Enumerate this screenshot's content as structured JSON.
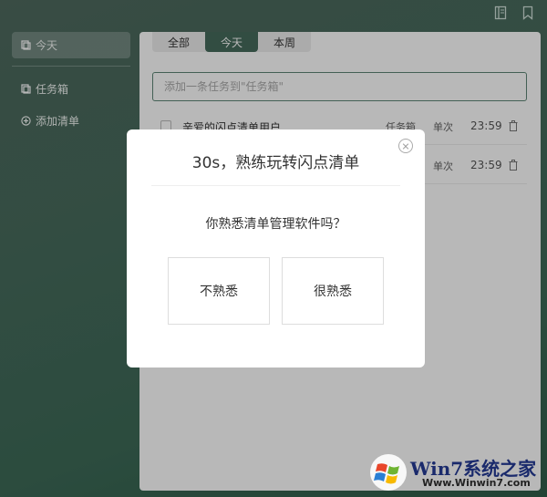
{
  "sidebar": {
    "today_label": "今天",
    "inbox_label": "任务箱",
    "add_list_label": "添加清单"
  },
  "tabs": [
    {
      "label": "全部"
    },
    {
      "label": "今天"
    },
    {
      "label": "本周"
    }
  ],
  "add_task": {
    "placeholder": "添加一条任务到\"任务箱\""
  },
  "tasks": [
    {
      "title": "亲爱的闪点清单用户",
      "list": "任务箱",
      "repeat": "单次",
      "time": "23:59"
    },
    {
      "title": "",
      "list": "",
      "repeat": "单次",
      "time": "23:59"
    }
  ],
  "modal": {
    "title": "30s，熟练玩转闪点清单",
    "question": "你熟悉清单管理软件吗？",
    "choice_unfamiliar": "不熟悉",
    "choice_familiar": "很熟悉"
  },
  "watermark": {
    "brand": "Win7系统之家",
    "url": "Www.Winwin7.com"
  },
  "colors": {
    "accent": "#466b5c",
    "background": "#3d6a57"
  }
}
